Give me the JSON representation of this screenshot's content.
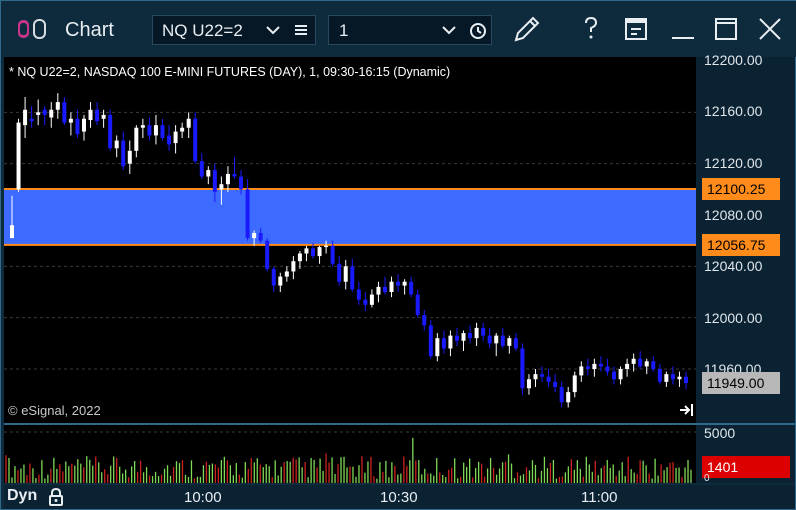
{
  "window": {
    "title": "Chart",
    "symbol_value": "NQ U22=2",
    "interval_value": "1"
  },
  "toolbar": {
    "icons": [
      "chart-app-icon",
      "chevron-down-icon",
      "menu-icon",
      "clock-icon",
      "pencil-icon",
      "help-icon",
      "page-icon",
      "minimize-icon",
      "maximize-icon",
      "close-icon"
    ]
  },
  "chart": {
    "header": "* NQ U22=2, NASDAQ 100 E-MINI FUTURES (DAY), 1, 09:30-16:15 (Dynamic)",
    "copyright": "© eSignal, 2022",
    "price_ticks": [
      "12200.00",
      "12160.00",
      "12120.00",
      "12080.00",
      "12040.00",
      "12000.00",
      "11960.00"
    ],
    "upper_line_label": "12100.25",
    "lower_line_label": "12056.75",
    "last_price_label": "11949.00",
    "volume_tick": "5000",
    "volume_label": "1401",
    "volume_tick_small": "0",
    "time_ticks": [
      "10:00",
      "10:30",
      "11:00"
    ],
    "mode_label": "Dyn"
  },
  "colors": {
    "up_candle": "#ffffff",
    "down_candle": "#1a1aff",
    "zone_fill": "#3d6bff",
    "zone_border": "#ff8c1a",
    "volume_up": "#7ed957",
    "volume_down": "#cc2222"
  },
  "chart_data": {
    "type": "candlestick",
    "y_range": [
      11930,
      12205
    ],
    "zone": {
      "upper": 12100.25,
      "lower": 12056.75
    },
    "last": 11949.0,
    "candles": [
      [
        12072,
        12095,
        12063,
        12062,
        1
      ],
      [
        12100,
        12155,
        12098,
        12152,
        1
      ],
      [
        12150,
        12172,
        12140,
        12162,
        1
      ],
      [
        12155,
        12165,
        12148,
        12153,
        0
      ],
      [
        12158,
        12170,
        12150,
        12160,
        1
      ],
      [
        12162,
        12165,
        12150,
        12158,
        0
      ],
      [
        12156,
        12168,
        12148,
        12162,
        1
      ],
      [
        12162,
        12175,
        12155,
        12168,
        1
      ],
      [
        12168,
        12172,
        12150,
        12152,
        0
      ],
      [
        12152,
        12160,
        12142,
        12155,
        1
      ],
      [
        12155,
        12162,
        12140,
        12143,
        0
      ],
      [
        12145,
        12158,
        12138,
        12155,
        1
      ],
      [
        12154,
        12168,
        12148,
        12162,
        1
      ],
      [
        12162,
        12168,
        12150,
        12153,
        0
      ],
      [
        12155,
        12162,
        12148,
        12158,
        1
      ],
      [
        12158,
        12162,
        12130,
        12132,
        0
      ],
      [
        12132,
        12142,
        12125,
        12138,
        1
      ],
      [
        12138,
        12145,
        12115,
        12118,
        0
      ],
      [
        12120,
        12138,
        12112,
        12130,
        1
      ],
      [
        12130,
        12150,
        12125,
        12148,
        1
      ],
      [
        12148,
        12155,
        12140,
        12150,
        1
      ],
      [
        12150,
        12156,
        12138,
        12142,
        0
      ],
      [
        12142,
        12158,
        12135,
        12150,
        1
      ],
      [
        12150,
        12155,
        12138,
        12140,
        0
      ],
      [
        12142,
        12150,
        12130,
        12135,
        0
      ],
      [
        12136,
        12150,
        12128,
        12145,
        1
      ],
      [
        12145,
        12152,
        12140,
        12148,
        1
      ],
      [
        12148,
        12160,
        12140,
        12155,
        1
      ],
      [
        12155,
        12160,
        12120,
        12122,
        0
      ],
      [
        12122,
        12128,
        12108,
        12110,
        0
      ],
      [
        12110,
        12118,
        12104,
        12115,
        1
      ],
      [
        12115,
        12120,
        12090,
        12098,
        0
      ],
      [
        12100,
        12110,
        12088,
        12104,
        1
      ],
      [
        12104,
        12118,
        12098,
        12112,
        1
      ],
      [
        12112,
        12125,
        12108,
        12110,
        0
      ],
      [
        12110,
        12115,
        12096,
        12100,
        0
      ],
      [
        12100,
        12108,
        12060,
        12062,
        0
      ],
      [
        12062,
        12068,
        12056,
        12066,
        1
      ],
      [
        12066,
        12070,
        12058,
        12060,
        0
      ],
      [
        12060,
        12062,
        12036,
        12038,
        0
      ],
      [
        12038,
        12040,
        12020,
        12025,
        0
      ],
      [
        12025,
        12035,
        12020,
        12032,
        1
      ],
      [
        12032,
        12040,
        12028,
        12036,
        1
      ],
      [
        12036,
        12048,
        12030,
        12044,
        1
      ],
      [
        12044,
        12052,
        12038,
        12050,
        1
      ],
      [
        12050,
        12056,
        12044,
        12054,
        1
      ],
      [
        12054,
        12058,
        12046,
        12048,
        0
      ],
      [
        12048,
        12056,
        12042,
        12055,
        1
      ],
      [
        12055,
        12060,
        12050,
        12056,
        1
      ],
      [
        12056,
        12060,
        12040,
        12042,
        0
      ],
      [
        12042,
        12048,
        12025,
        12028,
        0
      ],
      [
        12028,
        12045,
        12022,
        12040,
        1
      ],
      [
        12040,
        12046,
        12020,
        12022,
        0
      ],
      [
        12022,
        12028,
        12010,
        12014,
        0
      ],
      [
        12014,
        12020,
        12005,
        12010,
        0
      ],
      [
        12010,
        12022,
        12008,
        12018,
        1
      ],
      [
        12018,
        12028,
        12012,
        12024,
        1
      ],
      [
        12024,
        12032,
        12018,
        12020,
        0
      ],
      [
        12020,
        12032,
        12016,
        12028,
        1
      ],
      [
        12028,
        12034,
        12020,
        12025,
        0
      ],
      [
        12025,
        12030,
        12018,
        12028,
        1
      ],
      [
        12028,
        12032,
        12016,
        12018,
        0
      ],
      [
        12018,
        12022,
        12000,
        12002,
        0
      ],
      [
        12002,
        12006,
        11990,
        11994,
        0
      ],
      [
        11994,
        11998,
        11968,
        11970,
        0
      ],
      [
        11970,
        11988,
        11966,
        11984,
        1
      ],
      [
        11984,
        11990,
        11972,
        11976,
        0
      ],
      [
        11976,
        11990,
        11970,
        11986,
        1
      ],
      [
        11986,
        11992,
        11978,
        11982,
        0
      ],
      [
        11982,
        11990,
        11974,
        11988,
        1
      ],
      [
        11988,
        11994,
        11980,
        11984,
        0
      ],
      [
        11984,
        11996,
        11978,
        11992,
        1
      ],
      [
        11992,
        11996,
        11982,
        11986,
        0
      ],
      [
        11986,
        11992,
        11976,
        11980,
        0
      ],
      [
        11980,
        11988,
        11970,
        11986,
        1
      ],
      [
        11986,
        11992,
        11976,
        11978,
        0
      ],
      [
        11978,
        11986,
        11972,
        11984,
        1
      ],
      [
        11984,
        11988,
        11974,
        11976,
        0
      ],
      [
        11976,
        11980,
        11940,
        11945,
        0
      ],
      [
        11945,
        11956,
        11940,
        11952,
        1
      ],
      [
        11952,
        11960,
        11946,
        11956,
        1
      ],
      [
        11956,
        11962,
        11950,
        11954,
        0
      ],
      [
        11954,
        11960,
        11946,
        11950,
        0
      ],
      [
        11950,
        11956,
        11942,
        11946,
        0
      ],
      [
        11946,
        11950,
        11930,
        11934,
        0
      ],
      [
        11934,
        11946,
        11930,
        11942,
        1
      ],
      [
        11942,
        11958,
        11938,
        11955,
        1
      ],
      [
        11955,
        11966,
        11950,
        11962,
        1
      ],
      [
        11962,
        11968,
        11955,
        11960,
        0
      ],
      [
        11960,
        11968,
        11954,
        11964,
        1
      ],
      [
        11964,
        11970,
        11958,
        11962,
        0
      ],
      [
        11962,
        11968,
        11955,
        11958,
        0
      ],
      [
        11958,
        11962,
        11948,
        11952,
        0
      ],
      [
        11952,
        11962,
        11948,
        11960,
        1
      ],
      [
        11960,
        11968,
        11954,
        11964,
        1
      ],
      [
        11964,
        11972,
        11958,
        11968,
        1
      ],
      [
        11968,
        11974,
        11960,
        11962,
        0
      ],
      [
        11962,
        11968,
        11956,
        11966,
        1
      ],
      [
        11966,
        11970,
        11958,
        11960,
        0
      ],
      [
        11960,
        11964,
        11948,
        11950,
        0
      ],
      [
        11950,
        11958,
        11946,
        11956,
        1
      ],
      [
        11956,
        11962,
        11948,
        11952,
        0
      ],
      [
        11952,
        11958,
        11946,
        11954,
        1
      ],
      [
        11954,
        11958,
        11944,
        11949,
        0
      ]
    ],
    "volume_max": 6000
  }
}
